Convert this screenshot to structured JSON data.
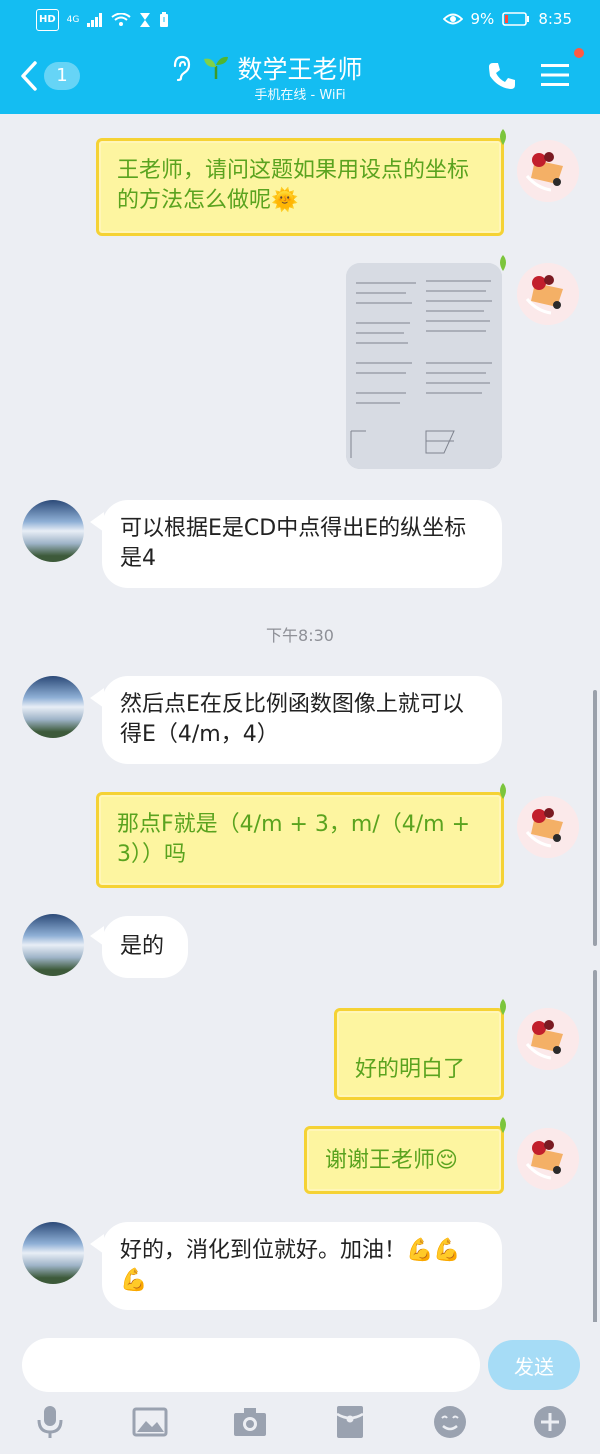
{
  "status": {
    "hd": "HD",
    "network": "4G",
    "battery_percent": "9%",
    "time": "8:35"
  },
  "header": {
    "back_count": "1",
    "title": "数学王老师",
    "subtitle": "手机在线 - WiFi"
  },
  "messages": [
    {
      "side": "right",
      "text": "王老师，请问这题如果用设点的坐标的方法怎么做呢🌞"
    },
    {
      "side": "right",
      "type": "image"
    },
    {
      "side": "left",
      "text": "可以根据E是CD中点得出E的纵坐标是4"
    },
    {
      "type": "timestamp",
      "text": "下午8:30"
    },
    {
      "side": "left",
      "text": "然后点E在反比例函数图像上就可以得E（4/m，4）"
    },
    {
      "side": "right",
      "text": "那点F就是（4/m + 3，m/（4/m + 3））吗"
    },
    {
      "side": "left",
      "text": "是的"
    },
    {
      "side": "right",
      "text": "好的明白了"
    },
    {
      "side": "right",
      "text": "谢谢王老师😌"
    },
    {
      "side": "left",
      "text": "好的，消化到位就好。加油！💪💪💪"
    }
  ],
  "input": {
    "placeholder": "",
    "send_label": "发送"
  },
  "colors": {
    "header_bg": "#14bdf2",
    "right_bubble_bg": "#fdf5a0",
    "right_bubble_border": "#f5d234",
    "right_bubble_text": "#5aa31f",
    "send_button": "#a6dcf6"
  },
  "icons": [
    "ear-icon",
    "sprout-icon",
    "phone-icon",
    "menu-icon",
    "microphone-icon",
    "image-icon",
    "camera-icon",
    "red-packet-icon",
    "emoji-icon",
    "plus-icon"
  ]
}
